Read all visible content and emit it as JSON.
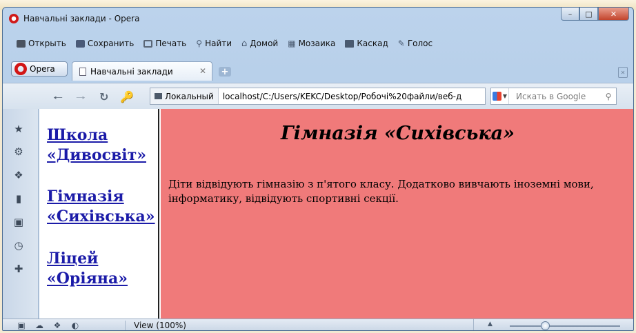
{
  "window": {
    "title": "Навчальні заклади - Opera",
    "controls": {
      "minimize": "–",
      "maximize": "□",
      "close": "✕"
    }
  },
  "toolbar": {
    "items": [
      {
        "label": "Открыть",
        "icon": "folder-icon"
      },
      {
        "label": "Сохранить",
        "icon": "save-icon"
      },
      {
        "label": "Печать",
        "icon": "print-icon"
      },
      {
        "label": "Найти",
        "icon": "find-icon"
      },
      {
        "label": "Домой",
        "icon": "home-icon"
      },
      {
        "label": "Мозаика",
        "icon": "tile-icon"
      },
      {
        "label": "Каскад",
        "icon": "cascade-icon"
      },
      {
        "label": "Голос",
        "icon": "voice-icon"
      }
    ]
  },
  "tabs": {
    "menu_label": "Opera",
    "active_tab": "Навчальні заклади",
    "close": "✕",
    "new_tab": "+"
  },
  "address": {
    "local_label": "Локальный",
    "url": "localhost/C:/Users/KEKC/Desktop/Робочі%20файли/веб-д",
    "search_placeholder": "Искать в Google"
  },
  "page": {
    "menu_links": [
      "Школа «Дивосвіт»",
      "Гімназія «Сихівська»",
      "Ліцей «Оріяна»"
    ],
    "heading": "Гімназія «Сихівська»",
    "text": "Діти відвідують гімназію з п'ятого класу. Додатково вивчають іноземні мови, інформатику, відвідують спортивні секції."
  },
  "status": {
    "view": "View (100%)",
    "zoom_level": 0.3
  },
  "colors": {
    "content_bg": "#f07a7a",
    "link": "#1b1ba8",
    "opera_red": "#d01a1a"
  }
}
